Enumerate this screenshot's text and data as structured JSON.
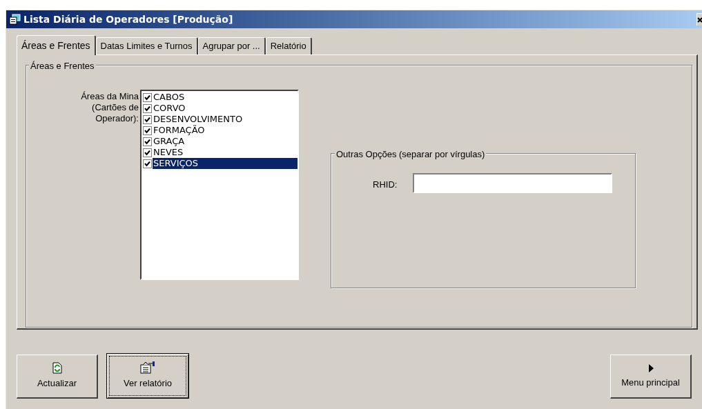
{
  "window": {
    "title": "Lista Diária de Operadores [Produção]"
  },
  "tabs": [
    {
      "label": "Áreas e Frentes",
      "selected": true
    },
    {
      "label": "Datas Limites e Turnos",
      "selected": false
    },
    {
      "label": "Agrupar por ...",
      "selected": false
    },
    {
      "label": "Relatório",
      "selected": false
    }
  ],
  "areas_group": {
    "title": "Áreas e Frentes",
    "list_label": "Áreas da Mina (Cartões de Operador):",
    "items": [
      {
        "label": "CABOS",
        "checked": true,
        "selected": false
      },
      {
        "label": "CORVO",
        "checked": true,
        "selected": false
      },
      {
        "label": "DESENVOLVIMENTO",
        "checked": true,
        "selected": false
      },
      {
        "label": "FORMAÇÃO",
        "checked": true,
        "selected": false
      },
      {
        "label": "GRAÇA",
        "checked": true,
        "selected": false
      },
      {
        "label": "NEVES",
        "checked": true,
        "selected": false
      },
      {
        "label": "SERVIÇOS",
        "checked": true,
        "selected": true
      }
    ]
  },
  "options_group": {
    "title": "Outras Opções (separar por vírgulas)",
    "rhid_label": "RHID:"
  },
  "buttons": [
    {
      "label": "Actualizar",
      "kind": "refresh",
      "focused": false
    },
    {
      "label": "Ver relatório",
      "kind": "report",
      "focused": true
    },
    {
      "label": "Menu principal",
      "kind": "menu",
      "focused": false
    }
  ]
}
